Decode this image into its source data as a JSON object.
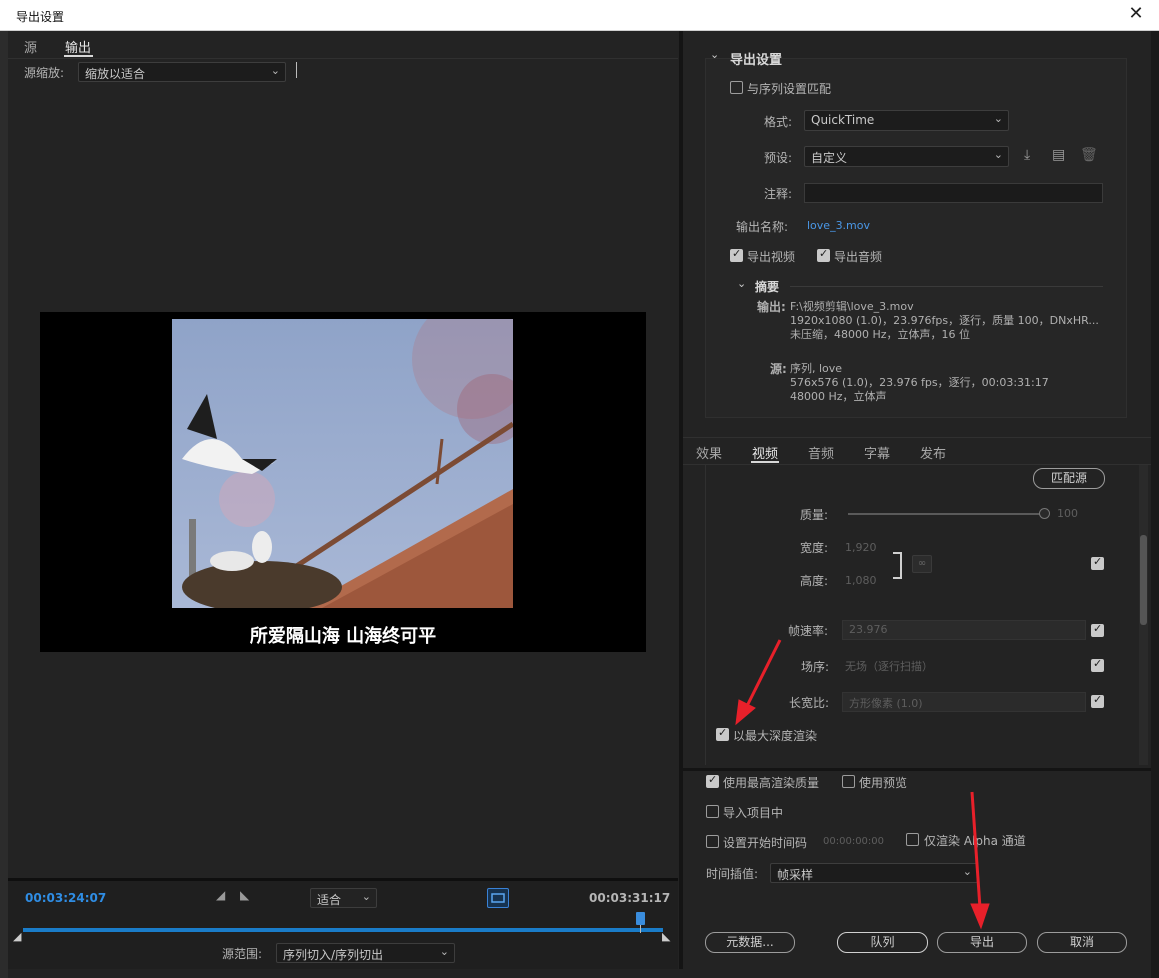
{
  "window": {
    "title": "导出设置",
    "close": "✕"
  },
  "left": {
    "tabs": [
      "源",
      "输出"
    ],
    "source_scale_label": "源缩放:",
    "source_scale_value": "缩放以适合",
    "subtitle": "所爱隔山海  山海终可平",
    "timebar": {
      "current_time": "00:03:24:07",
      "fit_value": "适合",
      "end_time": "00:03:31:17",
      "range_label": "源范围:",
      "range_value": "序列切入/序列切出"
    }
  },
  "export_settings": {
    "section_title": "导出设置",
    "match_sequence": "与序列设置匹配",
    "format_label": "格式:",
    "format_value": "QuickTime",
    "preset_label": "预设:",
    "preset_value": "自定义",
    "comment_label": "注释:",
    "comment_value": "",
    "output_name_label": "输出名称:",
    "output_name_value": "love_3.mov",
    "export_video": "导出视频",
    "export_audio": "导出音频",
    "summary_title": "摘要",
    "output_label": "输出:",
    "output_line1": "F:\\视频剪辑\\love_3.mov",
    "output_line2": "1920x1080 (1.0)，23.976fps，逐行，质量 100，DNxHR...",
    "output_line3": "未压缩，48000 Hz，立体声，16 位",
    "source_label": "源:",
    "source_line1": "序列, love",
    "source_line2": "576x576 (1.0)，23.976 fps，逐行，00:03:31:17",
    "source_line3": "48000 Hz，立体声"
  },
  "settings_tabs": [
    "效果",
    "视频",
    "音频",
    "字幕",
    "发布"
  ],
  "video": {
    "match_source": "匹配源",
    "quality_label": "质量:",
    "quality_value": "100",
    "quality_fraction": 1.0,
    "width_label": "宽度:",
    "width_value": "1,920",
    "height_label": "高度:",
    "height_value": "1,080",
    "framerate_label": "帧速率:",
    "framerate_value": "23.976",
    "field_order_label": "场序:",
    "field_order_value": "无场（逐行扫描）",
    "aspect_label": "长宽比:",
    "aspect_value": "方形像素 (1.0)",
    "max_depth": "以最大深度渲染"
  },
  "bottom": {
    "max_render_quality": "使用最高渲染质量",
    "use_previews": "使用预览",
    "import_project": "导入项目中",
    "set_start_timecode": "设置开始时间码",
    "start_timecode_value": "00:00:00:00",
    "render_alpha_only": "仅渲染 Alpha 通道",
    "time_interp_label": "时间插值:",
    "time_interp_value": "帧采样",
    "metadata_button": "元数据...",
    "queue_button": "队列",
    "export_button": "导出",
    "cancel_button": "取消"
  }
}
